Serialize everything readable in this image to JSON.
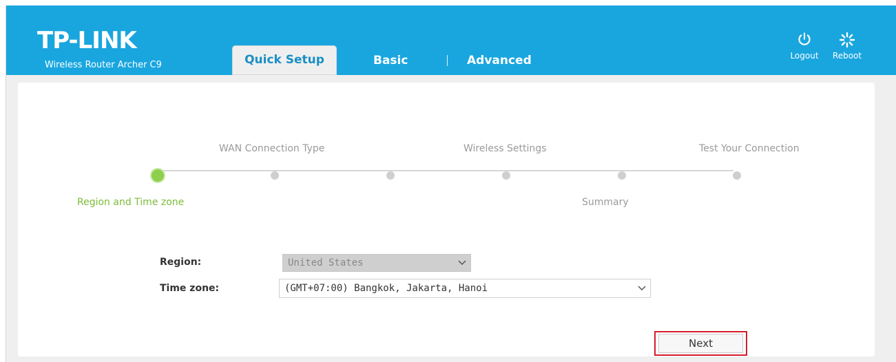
{
  "header": {
    "brand": "TP-LINK",
    "model": "Wireless Router Archer C9",
    "tabs": [
      {
        "label": "Quick Setup",
        "active": true
      },
      {
        "label": "Basic"
      },
      {
        "label": "Advanced"
      }
    ],
    "buttons": {
      "logout": {
        "label": "Logout",
        "icon": "power-icon"
      },
      "reboot": {
        "label": "Reboot",
        "icon": "spinner-icon"
      }
    },
    "colors": {
      "bar": "#19a6df",
      "active_tab_text": "#1a8fc4"
    }
  },
  "wizard": {
    "steps_top": [
      "WAN Connection Type",
      "Wireless Settings",
      "Test Your Connection"
    ],
    "steps_bottom": [
      "Region and Time zone",
      "Summary"
    ],
    "active_step": "Region and Time zone",
    "colors": {
      "active": "#7dbb3a",
      "inactive": "#cfcfcf"
    }
  },
  "form": {
    "region_label": "Region:",
    "region_value": "United States",
    "timezone_label": "Time zone:",
    "timezone_value": "(GMT+07:00) Bangkok, Jakarta, Hanoi"
  },
  "actions": {
    "next_label": "Next",
    "highlight_color": "#d41c2a"
  }
}
